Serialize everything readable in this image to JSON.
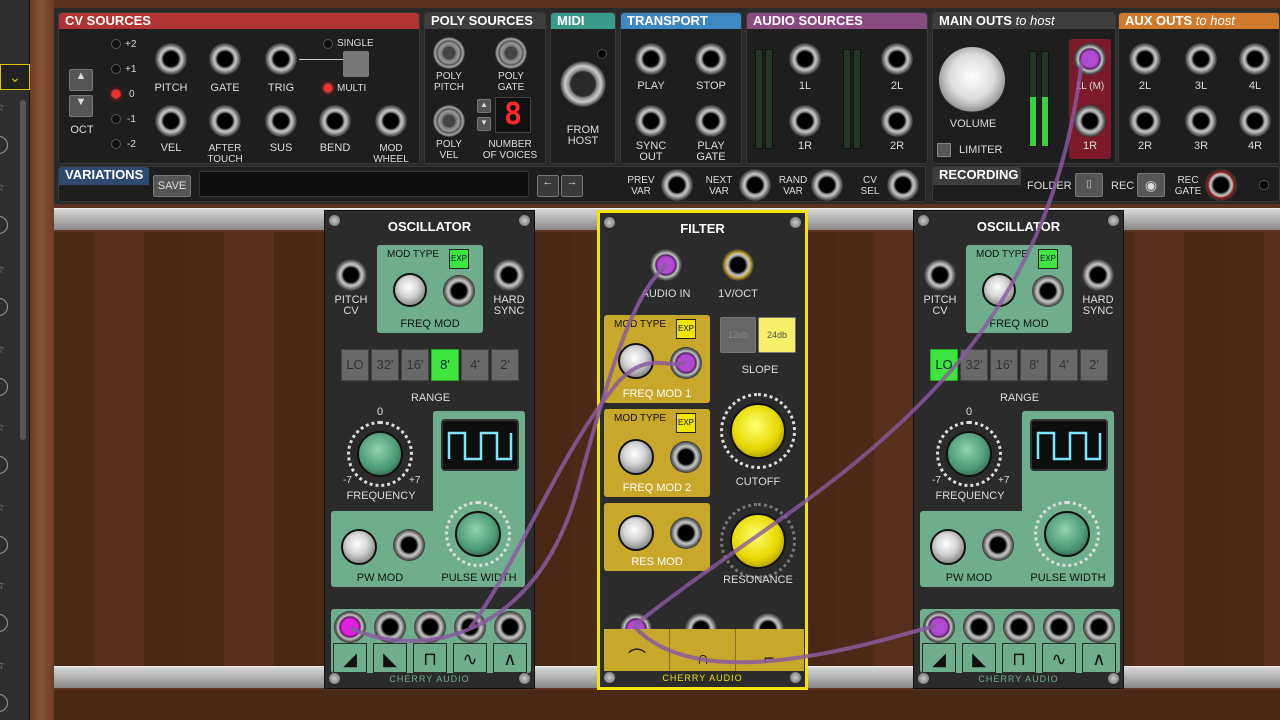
{
  "colors": {
    "cv": "#b03434",
    "poly": "#3e3e3e",
    "midi": "#3a9a8a",
    "transport": "#3f88c4",
    "audio": "#8a4a80",
    "main": "#3e3e3e",
    "aux": "#d07a2e",
    "filter_border": "#f2e600",
    "osc_green": "#6fae8c",
    "filter_gold": "#c8a82a",
    "range_on": "#3ee53e",
    "cable": "#8a5aa0"
  },
  "sidebar": {
    "selected_icon": "chevron-down-icon"
  },
  "cv_sources": {
    "title": "CV SOURCES",
    "oct_label": "OCT",
    "oct_values": [
      "+2",
      "+1",
      "0",
      "-1",
      "-2"
    ],
    "row1": [
      "PITCH",
      "GATE",
      "TRIG"
    ],
    "row2": [
      "VEL",
      "AFTER\nTOUCH",
      "SUS",
      "BEND",
      "MOD\nWHEEL"
    ],
    "single": "SINGLE",
    "multi": "MULTI"
  },
  "poly_sources": {
    "title": "POLY SOURCES",
    "poly_pitch": "POLY\nPITCH",
    "poly_gate": "POLY\nGATE",
    "poly_vel": "POLY\nVEL",
    "voices_value": "8",
    "voices_label": "NUMBER\nOF VOICES"
  },
  "midi": {
    "title": "MIDI",
    "from_host": "FROM\nHOST"
  },
  "transport": {
    "title": "TRANSPORT",
    "play": "PLAY",
    "stop": "STOP",
    "sync_out": "SYNC\nOUT",
    "play_gate": "PLAY\nGATE"
  },
  "audio_sources": {
    "title": "AUDIO SOURCES",
    "labels": [
      "1L",
      "2L",
      "1R",
      "2R"
    ]
  },
  "main_outs": {
    "title": "MAIN OUTS",
    "title_suffix": "to host",
    "volume": "VOLUME",
    "limiter": "LIMITER",
    "out_1l": "1L (M)",
    "out_1r": "1R"
  },
  "aux_outs": {
    "title": "AUX OUTS",
    "title_suffix": "to host",
    "top": [
      "2L",
      "3L",
      "4L"
    ],
    "bottom": [
      "2R",
      "3R",
      "4R"
    ]
  },
  "variations": {
    "title": "VARIATIONS",
    "save": "SAVE",
    "prev": "PREV\nVAR",
    "next": "NEXT\nVAR",
    "rand": "RAND\nVAR",
    "cv_sel": "CV\nSEL"
  },
  "recording": {
    "title": "RECORDING",
    "folder": "FOLDER",
    "rec": "REC",
    "rec_gate": "REC\nGATE"
  },
  "osc1": {
    "title": "OSCILLATOR",
    "pitch_cv": "PITCH\nCV",
    "mod_type": "MOD TYPE",
    "exp": "EXP",
    "freq_mod": "FREQ MOD",
    "hard_sync": "HARD\nSYNC",
    "range": [
      "LO",
      "32'",
      "16'",
      "8'",
      "4'",
      "2'"
    ],
    "range_selected": 3,
    "range_label": "RANGE",
    "freq_zero": "0",
    "freq_min": "-7",
    "freq_max": "+7",
    "frequency": "FREQUENCY",
    "pw_mod": "PW MOD",
    "pulse_width": "PULSE WIDTH",
    "waves": [
      "◢",
      "◣",
      "⊓",
      "∿",
      "∧"
    ],
    "brand": "CHERRY AUDIO"
  },
  "filter": {
    "title": "FILTER",
    "audio_in": "AUDIO IN",
    "v_oct": "1V/OCT",
    "mod_type": "MOD TYPE",
    "exp": "EXP",
    "freq_mod_1": "FREQ MOD 1",
    "freq_mod_2": "FREQ MOD 2",
    "slope_12": "12db",
    "slope_24": "24db",
    "slope": "SLOPE",
    "cutoff": "CUTOFF",
    "res_mod": "RES MOD",
    "resonance": "RESONANCE",
    "waves": [
      "⌒",
      "∩",
      "⌐"
    ],
    "brand": "CHERRY AUDIO"
  },
  "osc2": {
    "title": "OSCILLATOR",
    "pitch_cv": "PITCH\nCV",
    "mod_type": "MOD TYPE",
    "exp": "EXP",
    "freq_mod": "FREQ MOD",
    "hard_sync": "HARD\nSYNC",
    "range": [
      "LO",
      "32'",
      "16'",
      "8'",
      "4'",
      "2'"
    ],
    "range_selected": 0,
    "range_label": "RANGE",
    "freq_zero": "0",
    "freq_min": "-7",
    "freq_max": "+7",
    "frequency": "FREQUENCY",
    "pw_mod": "PW MOD",
    "pulse_width": "PULSE WIDTH",
    "waves": [
      "◢",
      "◣",
      "⊓",
      "∿",
      "∧"
    ],
    "brand": "CHERRY AUDIO"
  }
}
